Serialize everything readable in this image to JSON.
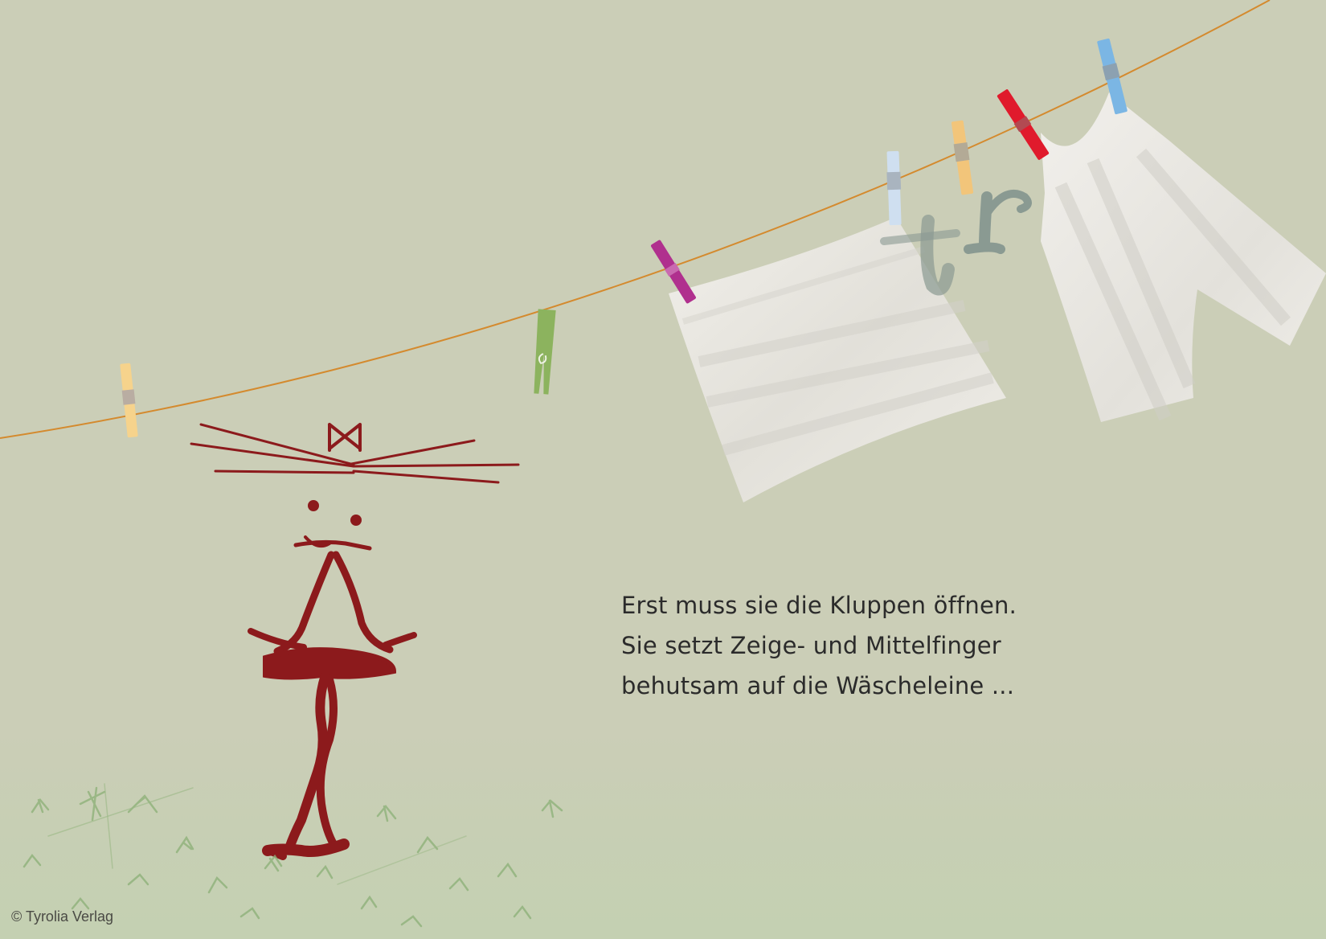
{
  "story": {
    "lines": [
      "Erst muss sie die Kluppen öffnen.",
      "Sie setzt Zeige- und Mittelfinger",
      "behutsam auf die Wäscheleine ..."
    ]
  },
  "copyright": "© Tyrolia Verlag",
  "colors": {
    "background": "#cbceb7",
    "line": "#d48a2e",
    "figure": "#8c1a1c",
    "grass": "#8fb27a",
    "cloth": "#eceae4",
    "text": "#2b2b2b"
  },
  "illustration": {
    "elements": [
      "clothesline",
      "peg-yellow",
      "peg-green",
      "peg-magenta",
      "peg-lightblue",
      "peg-orange",
      "peg-red",
      "peg-blue",
      "cloth-square",
      "cloth-shirt",
      "handwritten-tr",
      "cat-figure",
      "grass"
    ]
  }
}
